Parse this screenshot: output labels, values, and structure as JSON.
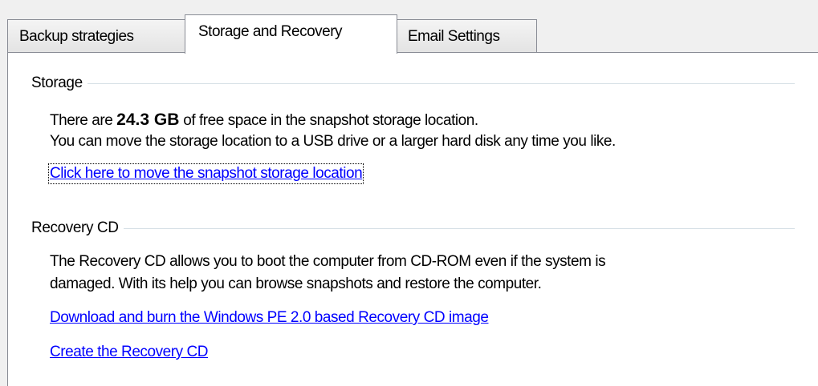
{
  "tabs": [
    {
      "label": "Backup strategies",
      "active": false
    },
    {
      "label": "Storage and Recovery",
      "active": true
    },
    {
      "label": "Email Settings",
      "active": false
    }
  ],
  "storage": {
    "header": "Storage",
    "line1_prefix": "There are ",
    "free_space": "24.3 GB",
    "line1_suffix": " of free space in the snapshot storage location.",
    "line2": "You can move the storage location to a USB drive or a larger hard disk any time you like.",
    "move_link": "Click here to move the snapshot storage location"
  },
  "recovery": {
    "header": "Recovery CD",
    "line1": "The Recovery CD allows you to boot the computer from CD-ROM even if the system is",
    "line2": "damaged. With its help you can browse snapshots and restore the computer.",
    "download_link": "Download and burn the Windows PE 2.0 based Recovery CD image",
    "create_link": "Create the Recovery CD"
  },
  "colors": {
    "link": "#0000ff",
    "panel_background": "#ffffff",
    "window_background": "#f0f0f0"
  }
}
